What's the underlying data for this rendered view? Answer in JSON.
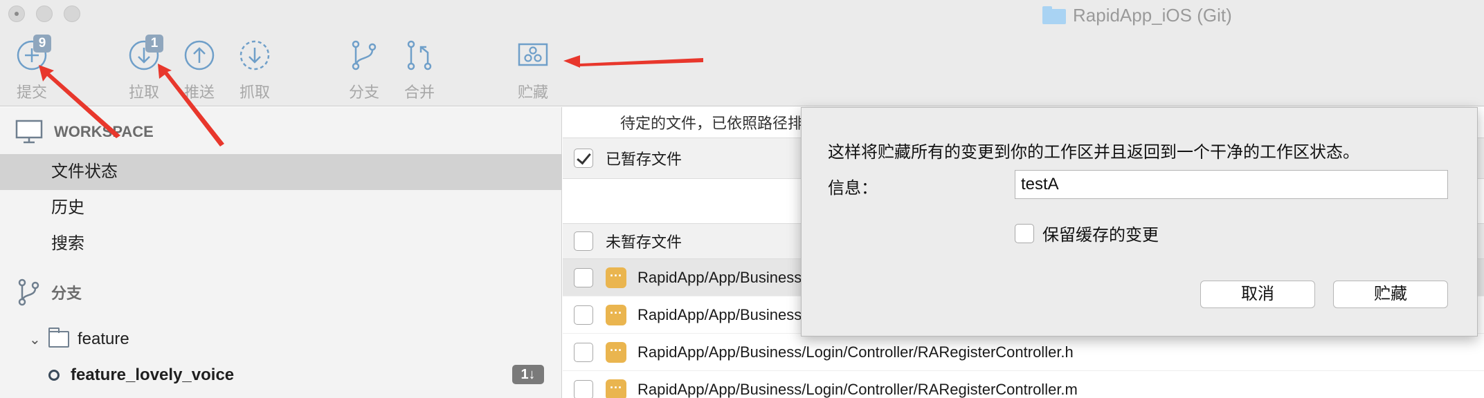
{
  "window": {
    "title": "RapidApp_iOS (Git)"
  },
  "toolbar": {
    "commit": {
      "label": "提交",
      "badge": "9",
      "icon": "plus-circle-icon"
    },
    "pull": {
      "label": "拉取",
      "badge": "1",
      "icon": "arrow-down-circle-icon"
    },
    "push": {
      "label": "推送",
      "icon": "arrow-up-circle-icon"
    },
    "fetch": {
      "label": "抓取",
      "icon": "arrow-down-dashed-circle-icon"
    },
    "branch": {
      "label": "分支",
      "icon": "branch-icon"
    },
    "merge": {
      "label": "合并",
      "icon": "merge-icon"
    },
    "stash": {
      "label": "贮藏",
      "icon": "stash-box-icon"
    }
  },
  "sidebar": {
    "workspace_label": "WORKSPACE",
    "items": [
      {
        "label": "文件状态",
        "selected": true
      },
      {
        "label": "历史",
        "selected": false
      },
      {
        "label": "搜索",
        "selected": false
      }
    ],
    "branches_label": "分支",
    "folder_label": "feature",
    "branch_name": "feature_lovely_voice",
    "branch_behind": "1↓"
  },
  "main": {
    "hint": "待定的文件，已依照路径排",
    "staged_label": "已暂存文件",
    "unstaged_label": "未暂存文件",
    "files": [
      {
        "path": "RapidApp/App/Business",
        "status": "···"
      },
      {
        "path": "RapidApp/App/Business",
        "status": "···"
      },
      {
        "path": "RapidApp/App/Business/Login/Controller/RARegisterController.h",
        "status": "···"
      },
      {
        "path": "RapidApp/App/Business/Login/Controller/RARegisterController.m",
        "status": "···"
      }
    ]
  },
  "dialog": {
    "message": "这样将贮藏所有的变更到你的工作区并且返回到一个干净的工作区状态。",
    "info_label": "信息：",
    "info_value": "testA",
    "keep_index_label": "保留缓存的变更",
    "keep_index_checked": false,
    "cancel_label": "取消",
    "stash_label": "贮藏"
  },
  "colors": {
    "accent_icon": "#6f9fc9",
    "badge": "#8fa6bd",
    "modified": "#eab54f",
    "annotation_arrow": "#e8372c"
  }
}
